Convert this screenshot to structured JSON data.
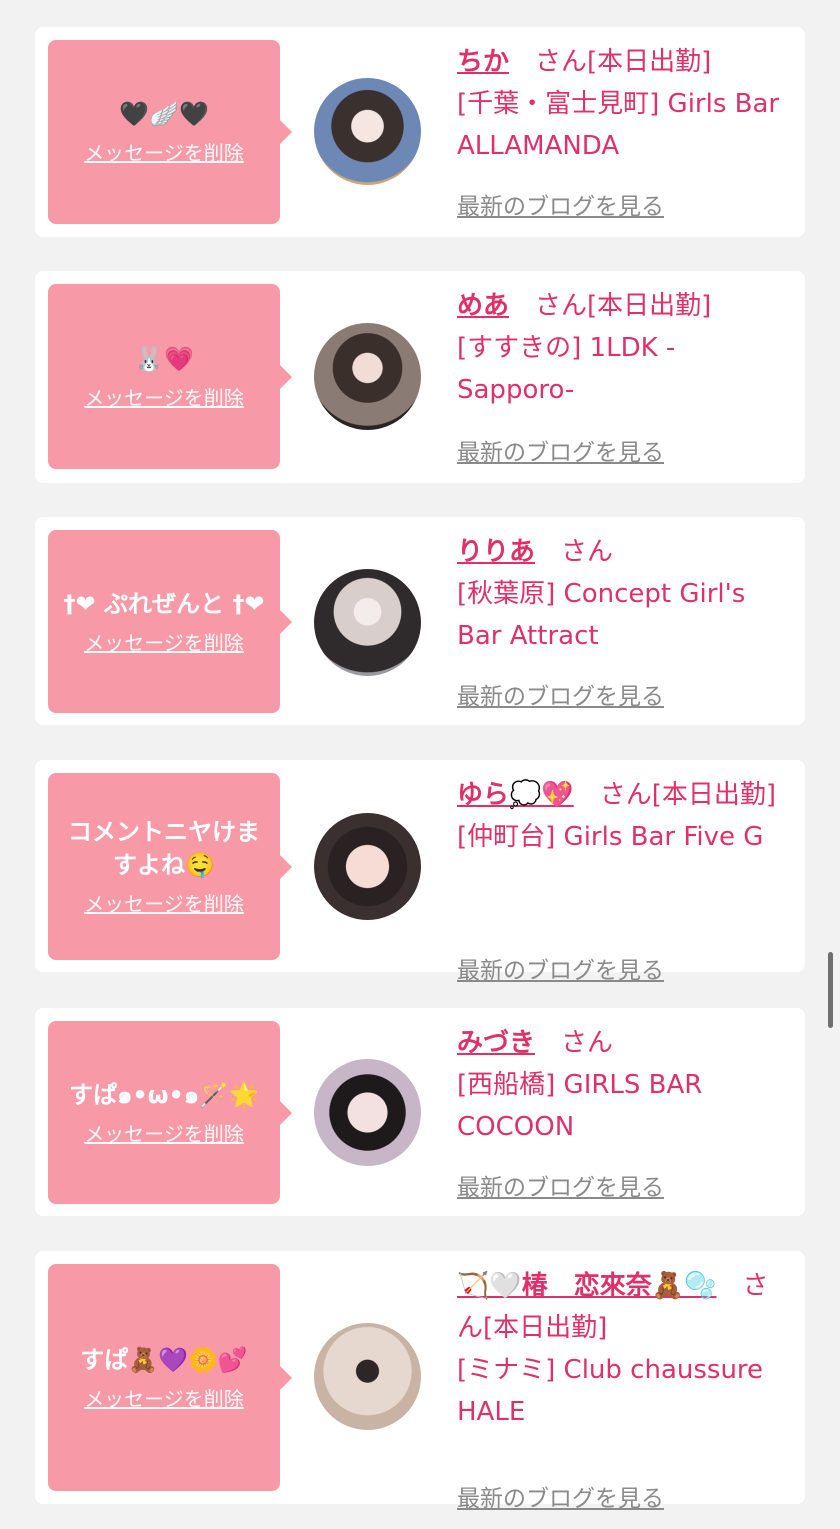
{
  "delete_label": "メッセージを削除",
  "blog_label": "最新のブログを見る",
  "cards": [
    {
      "message": "🖤🪽🖤",
      "name": "ちか",
      "suffix": "　さん[本日出勤]",
      "shop": "[千葉・富士見町] Girls Bar ALLAMANDA"
    },
    {
      "message": "🐰💗",
      "name": "めあ",
      "suffix": "　さん[本日出勤]",
      "shop": "[すすきの] 1LDK -Sapporo-"
    },
    {
      "message": "†❤ ぷれぜんと †❤",
      "name": "りりあ",
      "suffix": "　さん",
      "shop": "[秋葉原] Concept Girl's Bar Attract"
    },
    {
      "message": "コメントニヤけますよね🤤",
      "name": "ゆら💭💖",
      "suffix": "　さん[本日出勤]",
      "shop": "[仲町台] Girls Bar Five G"
    },
    {
      "message": "すぱ๑•ω•๑🪄🌟",
      "name": "みづき",
      "suffix": "　さん",
      "shop": "[西船橋] GIRLS BAR COCOON"
    },
    {
      "message": "すぱ🧸💜🌼💕",
      "name": "🏹🤍椿　恋來奈🧸🫧",
      "suffix": "　さん[本日出勤]",
      "shop": "[ミナミ] Club chaussure HALE"
    }
  ]
}
